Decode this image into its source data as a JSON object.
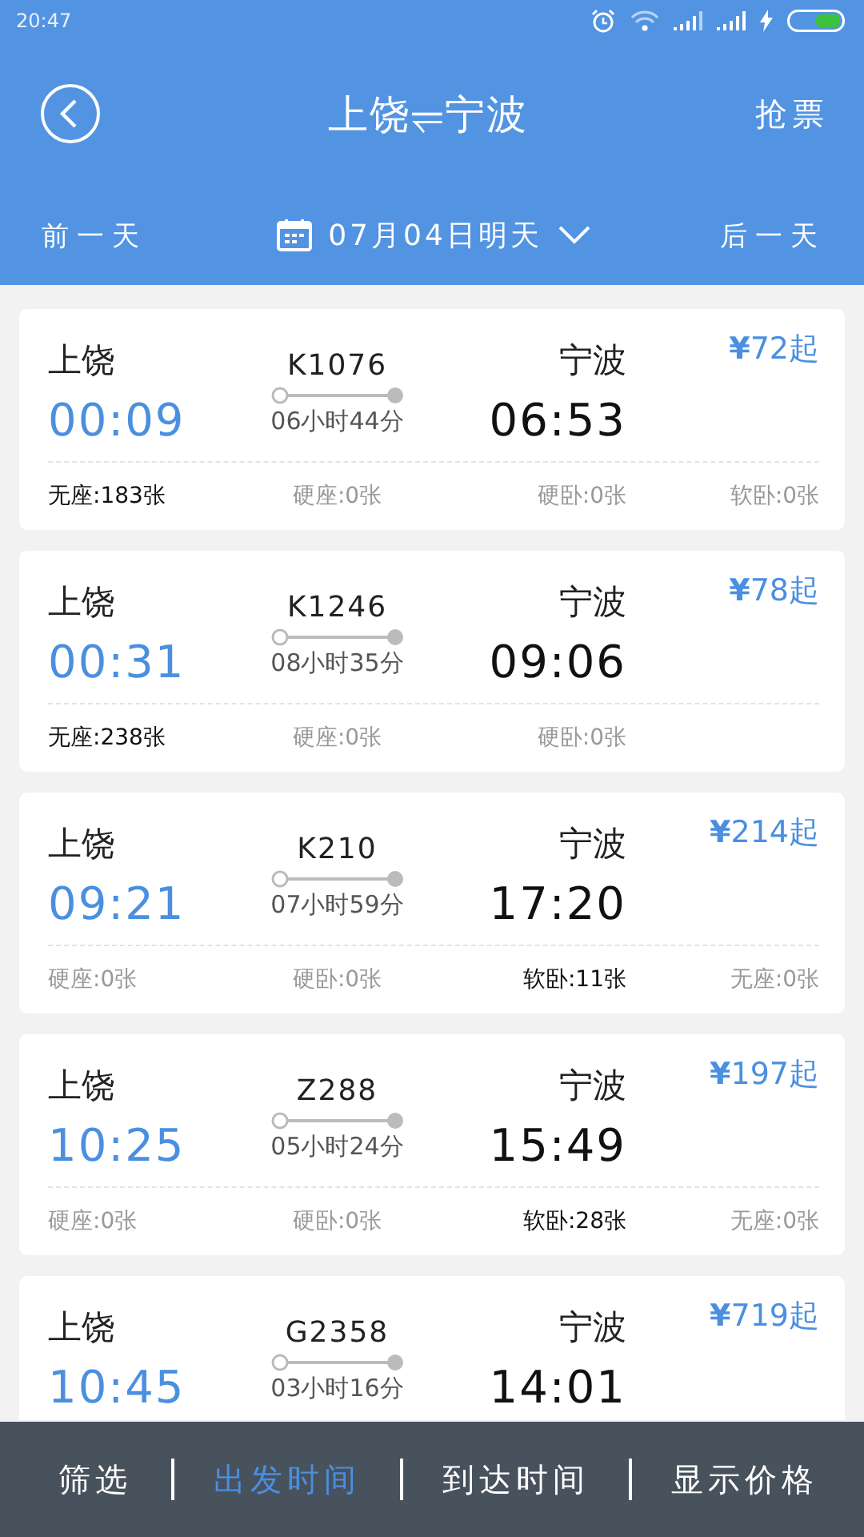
{
  "status_bar": {
    "time": "20:47"
  },
  "header": {
    "title": "上饶⥫宁波",
    "action": "抢票"
  },
  "date_bar": {
    "prev": "前一天",
    "date": "07月04日明天",
    "next": "后一天"
  },
  "trains": [
    {
      "origin": "上饶",
      "depart": "00:09",
      "number": "K1076",
      "duration": "06小时44分",
      "destination": "宁波",
      "arrive": "06:53",
      "price": "**¥**72起",
      "seats": [
        {
          "text": "无座:183张",
          "available": true
        },
        {
          "text": "硬座:0张",
          "available": false
        },
        {
          "text": "硬卧:0张",
          "available": false
        },
        {
          "text": "软卧:0张",
          "available": false
        }
      ]
    },
    {
      "origin": "上饶",
      "depart": "00:31",
      "number": "K1246",
      "duration": "08小时35分",
      "destination": "宁波",
      "arrive": "09:06",
      "price": "**¥**78起",
      "seats": [
        {
          "text": "无座:238张",
          "available": true
        },
        {
          "text": "硬座:0张",
          "available": false
        },
        {
          "text": "硬卧:0张",
          "available": false
        }
      ]
    },
    {
      "origin": "上饶",
      "depart": "09:21",
      "number": "K210",
      "duration": "07小时59分",
      "destination": "宁波",
      "arrive": "17:20",
      "price": "**¥**214起",
      "seats": [
        {
          "text": "硬座:0张",
          "available": false
        },
        {
          "text": "硬卧:0张",
          "available": false
        },
        {
          "text": "软卧:11张",
          "available": true
        },
        {
          "text": "无座:0张",
          "available": false
        }
      ]
    },
    {
      "origin": "上饶",
      "depart": "10:25",
      "number": "Z288",
      "duration": "05小时24分",
      "destination": "宁波",
      "arrive": "15:49",
      "price": "**¥**197起",
      "seats": [
        {
          "text": "硬座:0张",
          "available": false
        },
        {
          "text": "硬卧:0张",
          "available": false
        },
        {
          "text": "软卧:28张",
          "available": true
        },
        {
          "text": "无座:0张",
          "available": false
        }
      ]
    },
    {
      "origin": "上饶",
      "depart": "10:45",
      "number": "G2358",
      "duration": "03小时16分",
      "destination": "宁波",
      "arrive": "14:01",
      "price": "**¥**719起"
    }
  ],
  "bottom_bar": [
    {
      "label": "筛选",
      "selected": false
    },
    {
      "label": "出发时间",
      "selected": true
    },
    {
      "label": "到达时间",
      "selected": false
    },
    {
      "label": "显示价格",
      "selected": false
    }
  ]
}
